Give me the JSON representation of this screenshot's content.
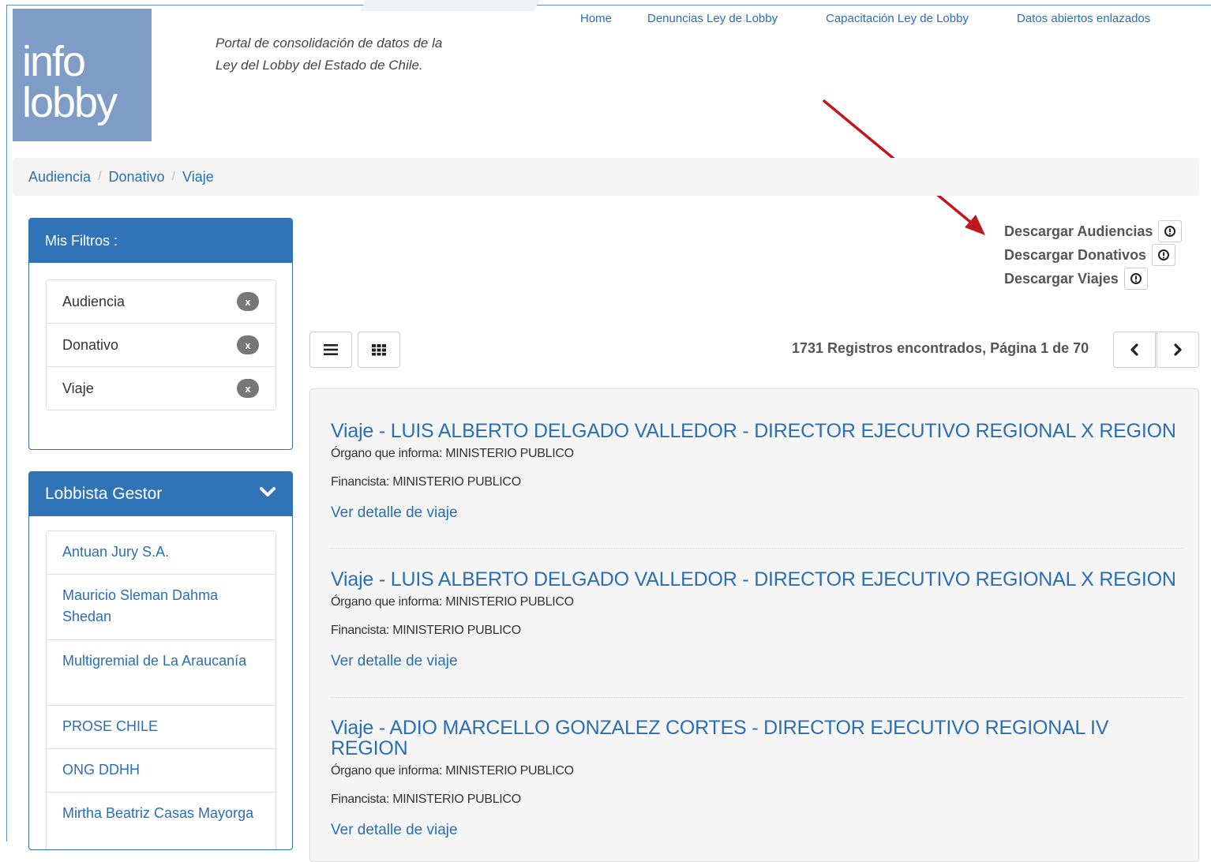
{
  "logo": {
    "line1": "info",
    "line2": "lobby"
  },
  "tagline": {
    "line1": "Portal de consolidación de datos de la",
    "line2": "Ley del Lobby del Estado de Chile."
  },
  "nav": {
    "home": "Home",
    "denuncias": "Denuncias Ley de Lobby",
    "capacitacion": "Capacitación Ley de Lobby",
    "datos": "Datos abiertos enlazados"
  },
  "breadcrumb": [
    "Audiencia",
    "Donativo",
    "Viaje"
  ],
  "filters": {
    "title": "Mis Filtros :",
    "items": [
      "Audiencia",
      "Donativo",
      "Viaje"
    ],
    "remove_label": "x"
  },
  "lobbyist": {
    "title": "Lobbista Gestor",
    "items": [
      "Antuan Jury S.A.",
      "Mauricio Sleman Dahma Shedan",
      "Multigremial de La Araucanía",
      "PROSE CHILE",
      "ONG DDHH",
      "Mirtha Beatriz Casas Mayorga"
    ]
  },
  "downloads": [
    "Descargar Audiencias",
    "Descargar Donativos",
    "Descargar Viajes"
  ],
  "results_count": "1731 Registros encontrados, Página 1 de 70",
  "results": [
    {
      "title": "Viaje - LUIS ALBERTO DELGADO VALLEDOR - DIRECTOR EJECUTIVO REGIONAL X REGION",
      "organo": "Órgano que informa: MINISTERIO PUBLICO",
      "financista": "Financista: MINISTERIO PUBLICO",
      "link": "Ver detalle de viaje"
    },
    {
      "title": "Viaje - LUIS ALBERTO DELGADO VALLEDOR - DIRECTOR EJECUTIVO REGIONAL X REGION",
      "organo": "Órgano que informa: MINISTERIO PUBLICO",
      "financista": "Financista: MINISTERIO PUBLICO",
      "link": "Ver detalle de viaje"
    },
    {
      "title": "Viaje - ADIO MARCELLO GONZALEZ CORTES - DIRECTOR EJECUTIVO REGIONAL IV REGION",
      "organo": "Órgano que informa: MINISTERIO PUBLICO",
      "financista": "Financista: MINISTERIO PUBLICO",
      "link": "Ver detalle de viaje"
    }
  ],
  "colors": {
    "brand": "#3173b7",
    "link": "#2a6fb4",
    "logo_bg": "#7e9cc5",
    "arrow": "#c0161c"
  }
}
